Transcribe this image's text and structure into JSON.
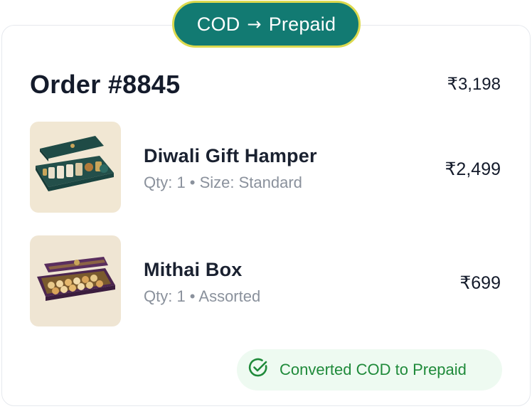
{
  "banner": {
    "from": "COD",
    "arrow": "→",
    "to": "Prepaid"
  },
  "order": {
    "title": "Order #8845",
    "total": "₹3,198"
  },
  "items": [
    {
      "name": "Diwali Gift Hamper",
      "meta": "Qty: 1 • Size: Standard",
      "price": "₹2,499",
      "image": "gift-hamper-image"
    },
    {
      "name": "Mithai Box",
      "meta": "Qty: 1 • Assorted",
      "price": "₹699",
      "image": "mithai-box-image"
    }
  ],
  "status": {
    "label": "Converted COD to Prepaid",
    "icon": "check-circle-icon",
    "color": "#1f8a3a"
  },
  "colors": {
    "accent": "#127a72",
    "accent_border": "#dcd94e",
    "success_bg": "#eefaf1"
  }
}
